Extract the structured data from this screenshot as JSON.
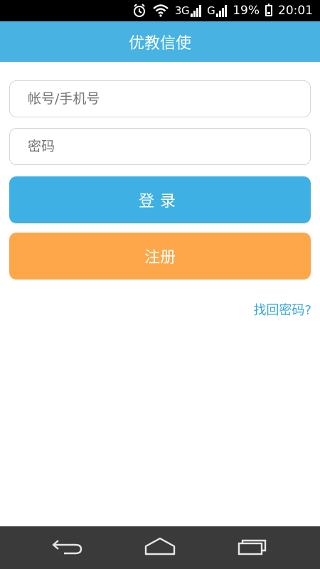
{
  "status_bar": {
    "network_1": "3G",
    "network_2": "G",
    "battery": "19%",
    "time": "20:01",
    "icons": [
      "alarm-icon",
      "wifi-icon",
      "signal-icon",
      "battery-icon"
    ]
  },
  "title_bar": {
    "title": "优教信使"
  },
  "login_form": {
    "account_placeholder": "帐号/手机号",
    "password_placeholder": "密码",
    "login_label": "登录",
    "register_label": "注册",
    "forgot_label": "找回密码?"
  },
  "nav_bar": {
    "icons": [
      "back-icon",
      "home-icon",
      "recent-apps-icon"
    ]
  },
  "colors": {
    "title_bar": "#48b3e2",
    "login_button": "#3eb0e3",
    "register_button": "#fda74a",
    "link": "#3aa8da",
    "nav_bar": "#3a3a3a"
  }
}
